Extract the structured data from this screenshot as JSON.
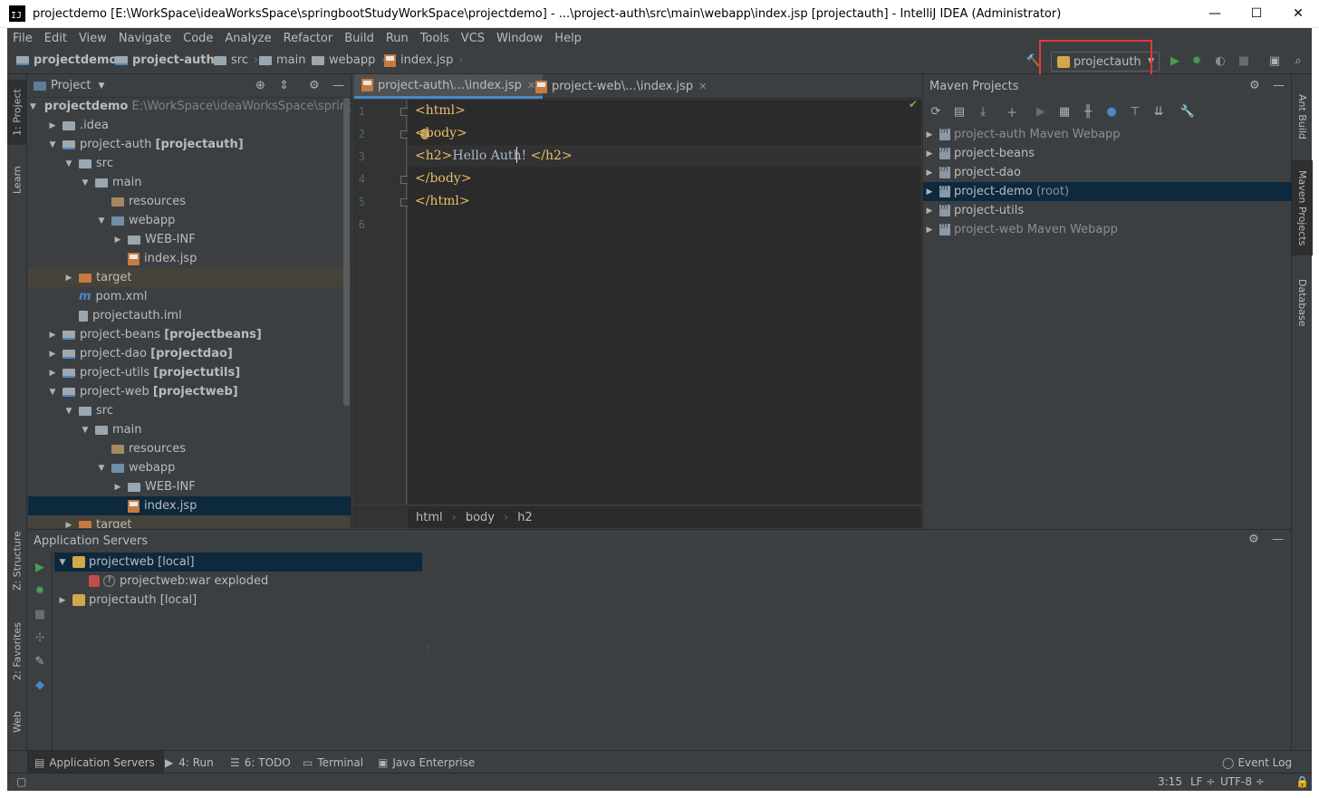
{
  "window": {
    "title": "projectdemo [E:\\WorkSpace\\ideaWorksSpace\\springbootStudyWorkSpace\\projectdemo] - ...\\project-auth\\src\\main\\webapp\\index.jsp [projectauth] - IntelliJ IDEA (Administrator)",
    "app_icon_text": "IJ",
    "minimize": "—",
    "maximize": "☐",
    "close": "✕"
  },
  "menu": [
    "File",
    "Edit",
    "View",
    "Navigate",
    "Code",
    "Analyze",
    "Refactor",
    "Build",
    "Run",
    "Tools",
    "VCS",
    "Window",
    "Help"
  ],
  "breadcrumb": [
    "projectdemo",
    "project-auth",
    "src",
    "main",
    "webapp",
    "index.jsp"
  ],
  "run_config": {
    "selected": "projectauth"
  },
  "left_stripe": {
    "project": "1: Project",
    "learn": "Learn",
    "structure": "Z: Structure",
    "favorites": "2: Favorites",
    "web": "Web"
  },
  "right_stripe": {
    "ant": "Ant Build",
    "maven": "Maven Projects",
    "database": "Database"
  },
  "project_panel": {
    "header": "Project",
    "tree": [
      {
        "label": "projectdemo",
        "extra": "E:\\WorkSpace\\ideaWorksSpace\\springb"
      },
      {
        "label": ".idea"
      },
      {
        "label": "project-auth",
        "extra": "[projectauth]"
      },
      {
        "label": "src"
      },
      {
        "label": "main"
      },
      {
        "label": "resources"
      },
      {
        "label": "webapp"
      },
      {
        "label": "WEB-INF"
      },
      {
        "label": "index.jsp"
      },
      {
        "label": "target"
      },
      {
        "label": "pom.xml"
      },
      {
        "label": "projectauth.iml"
      },
      {
        "label": "project-beans",
        "extra": "[projectbeans]"
      },
      {
        "label": "project-dao",
        "extra": "[projectdao]"
      },
      {
        "label": "project-utils",
        "extra": "[projectutils]"
      },
      {
        "label": "project-web",
        "extra": "[projectweb]"
      },
      {
        "label": "src"
      },
      {
        "label": "main"
      },
      {
        "label": "resources"
      },
      {
        "label": "webapp"
      },
      {
        "label": "WEB-INF"
      },
      {
        "label": "index.jsp"
      },
      {
        "label": "target"
      }
    ]
  },
  "editor": {
    "tabs": [
      {
        "label": "project-auth\\...\\index.jsp",
        "close": "✕"
      },
      {
        "label": "project-web\\...\\index.jsp",
        "close": "✕"
      }
    ],
    "line_numbers": [
      "1",
      "2",
      "3",
      "4",
      "5",
      "6"
    ],
    "code": {
      "l1": "<html>",
      "l2": "<body>",
      "l3a": "<h2>",
      "l3b": "Hello Auth! ",
      "l3c": "</h2>",
      "l4": "</body>",
      "l5": "</html>"
    },
    "breadcrumb": [
      "html",
      "body",
      "h2"
    ]
  },
  "maven": {
    "header": "Maven Projects",
    "projects": [
      {
        "name": "project-auth",
        "suffix": "Maven Webapp"
      },
      {
        "name": "project-beans",
        "suffix": ""
      },
      {
        "name": "project-dao",
        "suffix": ""
      },
      {
        "name": "project-demo",
        "suffix": "(root)"
      },
      {
        "name": "project-utils",
        "suffix": ""
      },
      {
        "name": "project-web",
        "suffix": "Maven Webapp"
      }
    ]
  },
  "app_servers": {
    "header": "Application Servers",
    "items": [
      {
        "label": "projectweb [local]"
      },
      {
        "label": "projectweb:war exploded"
      },
      {
        "label": "projectauth [local]"
      }
    ]
  },
  "bottom_tabs": {
    "app_servers": "Application Servers",
    "run": "4: Run",
    "todo": "6: TODO",
    "terminal": "Terminal",
    "java_ee": "Java Enterprise",
    "event_log": "Event Log"
  },
  "status": {
    "position": "3:15",
    "line_sep": "LF ÷",
    "encoding": "UTF-8 ÷"
  },
  "colors": {
    "accent": "#4a88c7",
    "selection": "#0d293e",
    "tag": "#e8bf6a",
    "annotation": "#e53935",
    "run_green": "#499c54"
  }
}
